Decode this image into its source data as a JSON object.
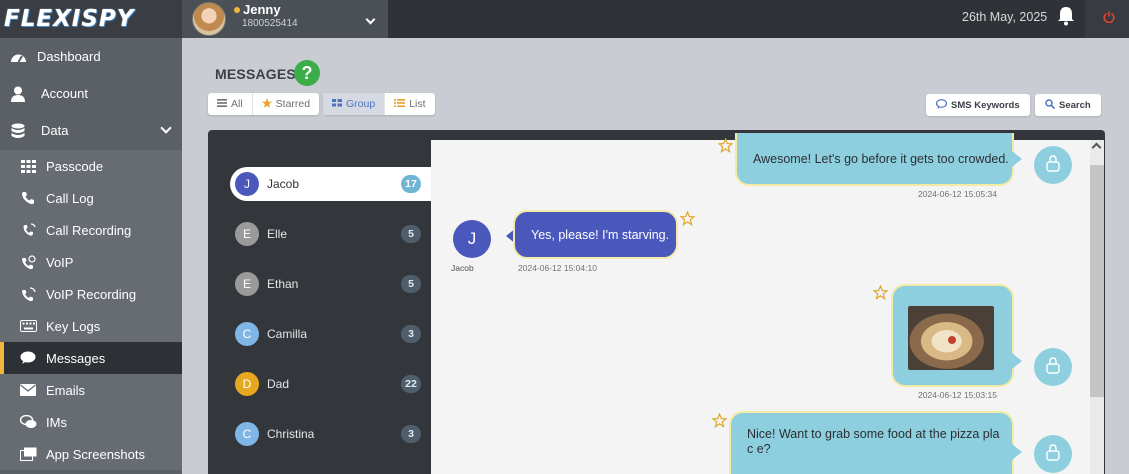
{
  "brand": {
    "logo_text": "FLEXISPY"
  },
  "user": {
    "name": "Jenny",
    "phone": "1800525414"
  },
  "topbar": {
    "date": "26th May, 2025"
  },
  "sidebar": {
    "items": [
      {
        "label": "Dashboard",
        "icon": "dashboard-icon"
      },
      {
        "label": "Account",
        "icon": "user-icon"
      },
      {
        "label": "Data",
        "icon": "database-icon"
      },
      {
        "label": "Passcode",
        "icon": "keypad-icon"
      },
      {
        "label": "Call Log",
        "icon": "phone-icon"
      },
      {
        "label": "Call Recording",
        "icon": "call-recording-icon"
      },
      {
        "label": "VoIP",
        "icon": "voip-icon"
      },
      {
        "label": "VoIP Recording",
        "icon": "voip-recording-icon"
      },
      {
        "label": "Key Logs",
        "icon": "keyboard-icon"
      },
      {
        "label": "Messages",
        "icon": "chat-icon",
        "active": true
      },
      {
        "label": "Emails",
        "icon": "envelope-icon"
      },
      {
        "label": "IMs",
        "icon": "im-icon"
      },
      {
        "label": "App Screenshots",
        "icon": "screenshot-icon"
      }
    ]
  },
  "page": {
    "title": "MESSAGES",
    "help": "?"
  },
  "filters": {
    "all": "All",
    "starred": "Starred",
    "group": "Group",
    "list": "List"
  },
  "tools": {
    "sms_keywords": "SMS Keywords",
    "search": "Search"
  },
  "contacts": [
    {
      "initial": "J",
      "name": "Jacob",
      "count": "17",
      "color": "#4a58bb",
      "active": true
    },
    {
      "initial": "E",
      "name": "Elle",
      "count": "5",
      "color": "#9a9a9a"
    },
    {
      "initial": "E",
      "name": "Ethan",
      "count": "5",
      "color": "#9a9a9a"
    },
    {
      "initial": "C",
      "name": "Camilla",
      "count": "3",
      "color": "#7fb6e6"
    },
    {
      "initial": "D",
      "name": "Dad",
      "count": "22",
      "color": "#e6a81e"
    },
    {
      "initial": "C",
      "name": "Christina",
      "count": "3",
      "color": "#7fb6e6"
    }
  ],
  "messages": [
    {
      "direction": "outgoing",
      "text": "Awesome! Let's go before it gets too crowded.",
      "time": "2024-06-12 15:05:34"
    },
    {
      "direction": "incoming",
      "sender": "Jacob",
      "initial": "J",
      "text": "Yes, please! I'm starving.",
      "time": "2024-06-12 15:04:10"
    },
    {
      "direction": "outgoing",
      "attachment": "pizza-photo",
      "time": "2024-06-12 15:03:15"
    },
    {
      "direction": "outgoing",
      "text": "Nice! Want to grab some food at the pizza plac e?"
    }
  ],
  "colors": {
    "accent": "#f0b73a",
    "outgoing_bubble": "#8ecfdf",
    "incoming_bubble": "#4a58bb",
    "help": "#3cae49"
  }
}
